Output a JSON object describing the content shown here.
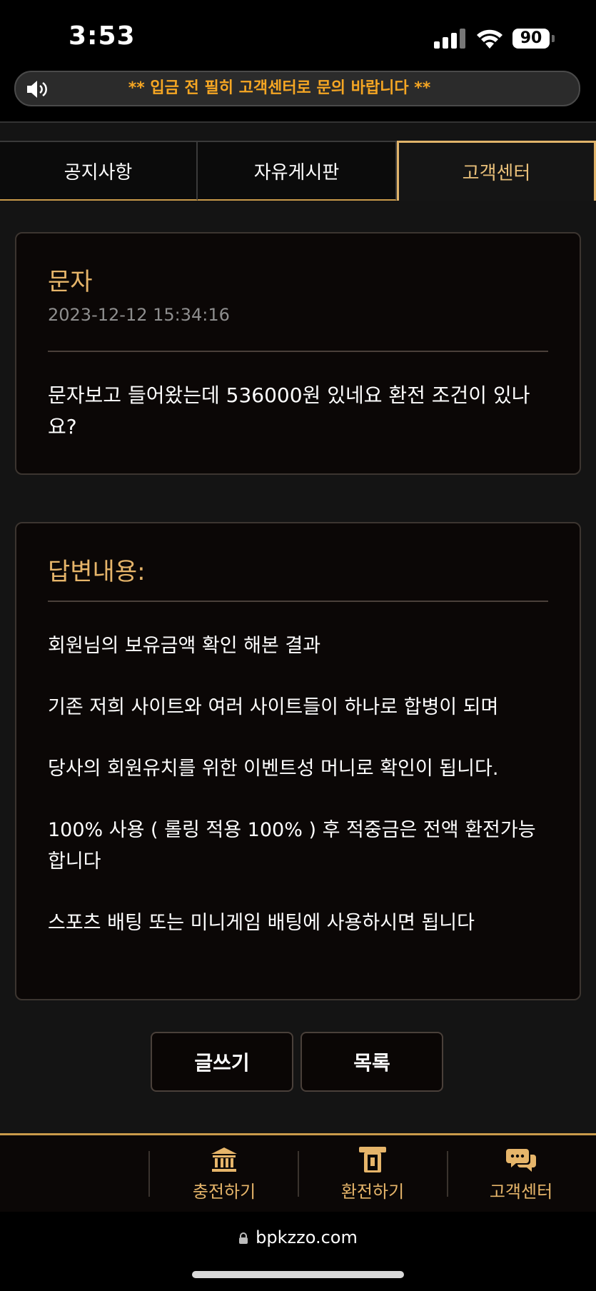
{
  "status_bar": {
    "time": "3:53",
    "battery": "90"
  },
  "marquee": {
    "text": "** 입금 전 필히 고객센터로 문의 바랍니다 **"
  },
  "tabs": [
    {
      "label": "공지사항"
    },
    {
      "label": "자유게시판"
    },
    {
      "label": "고객센터",
      "active": true
    }
  ],
  "question": {
    "title": "문자",
    "date": "2023-12-12 15:34:16",
    "body": "문자보고 들어왔는데 536000원 있네요 환전 조건이 있나요?"
  },
  "answer": {
    "title": "답변내용:",
    "paragraphs": [
      "회원님의 보유금액 확인 해본 결과",
      "기존 저희 사이트와 여러 사이트들이 하나로 합병이 되며",
      "당사의 회원유치를 위한 이벤트성 머니로 확인이 됩니다.",
      "100% 사용 ( 롤링 적용 100% ) 후 적중금은 전액 환전가능 합니다",
      "스포츠 배팅 또는 미니게임 배팅에 사용하시면 됩니다"
    ]
  },
  "buttons": {
    "write": "글쓰기",
    "list": "목록"
  },
  "bottom_nav": [
    {
      "label": "충전하기",
      "icon": "bank-icon"
    },
    {
      "label": "환전하기",
      "icon": "atm-card-icon"
    },
    {
      "label": "고객센터",
      "icon": "chat-bubbles-icon"
    }
  ],
  "browser": {
    "url": "bpkzzo.com"
  },
  "colors": {
    "accent": "#e6b56a",
    "marquee_text": "#f5a623",
    "background": "#141414"
  }
}
